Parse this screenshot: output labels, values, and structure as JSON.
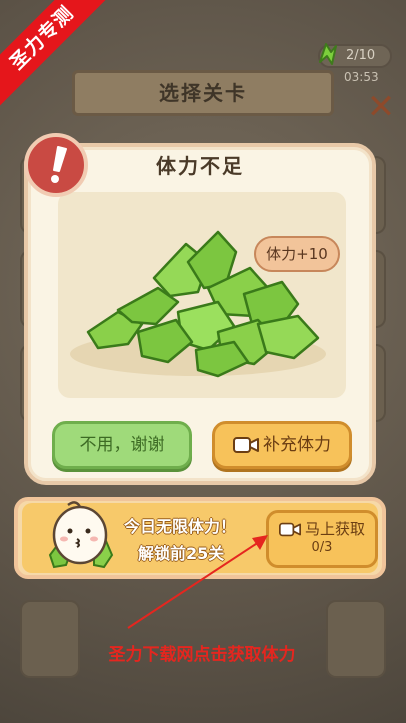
{
  "watermark": {
    "ribbon_text": "圣力专测"
  },
  "status": {
    "energy_value": "2/10",
    "energy_timer": "03:53",
    "energy_icon": "green-leaf-bolt-icon"
  },
  "header": {
    "title": "选择关卡",
    "close_icon": "close-x-icon"
  },
  "dialog": {
    "title": "体力不足",
    "badge_icon": "exclamation-icon",
    "reward_bubble": "体力+10",
    "art": "green-leaf-pile-illustration",
    "btn_decline": "不用，谢谢",
    "btn_refill": "补充体力",
    "btn_refill_icon": "video-camera-icon"
  },
  "promo": {
    "line1": "今日无限体力！",
    "line2": "解锁前25关",
    "btn_label": "马上获取",
    "btn_count": "0/3",
    "btn_icon": "video-camera-icon"
  },
  "annotation": {
    "text": "圣力下载网点击获取体力"
  },
  "colors": {
    "accent_red": "#e5161b",
    "dialog_bg": "#faf4e4",
    "green_button": "#9fda7a",
    "orange_button": "#f7c25a"
  }
}
